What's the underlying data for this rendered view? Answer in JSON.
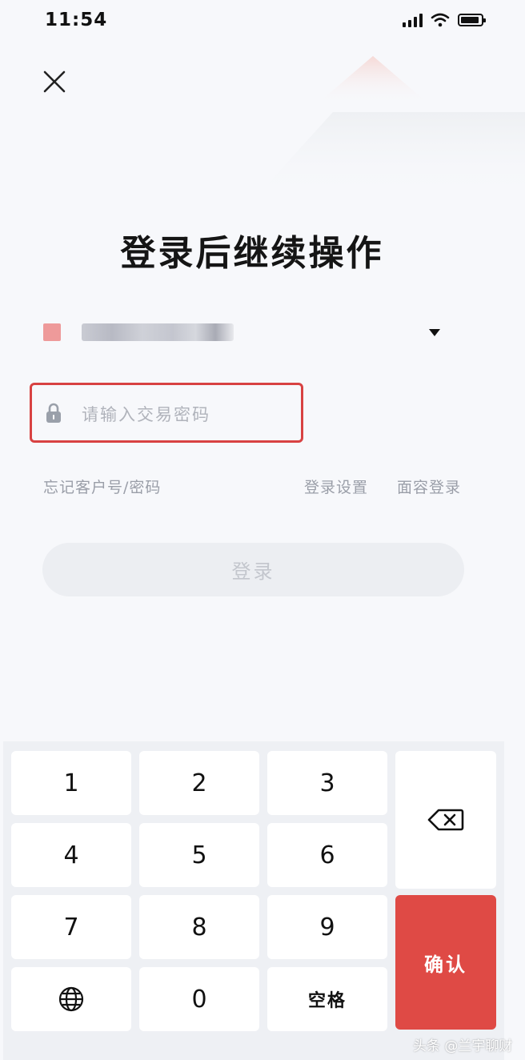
{
  "status_bar": {
    "time": "11:54"
  },
  "page": {
    "title": "登录后继续操作"
  },
  "login_form": {
    "password_placeholder": "请输入交易密码",
    "forgot_label": "忘记客户号/密码",
    "settings_label": "登录设置",
    "face_login_label": "面容登录",
    "login_button": "登录"
  },
  "keypad": {
    "keys": [
      "1",
      "2",
      "3",
      "4",
      "5",
      "6",
      "7",
      "8",
      "9",
      "0"
    ],
    "space_label": "空格",
    "confirm_label": "确认",
    "globe_icon": "globe-icon",
    "backspace_icon": "backspace-icon"
  },
  "watermark": "头条 @兰宇聊财",
  "colors": {
    "accent": "#df4a45",
    "highlight_border": "#d84242"
  }
}
